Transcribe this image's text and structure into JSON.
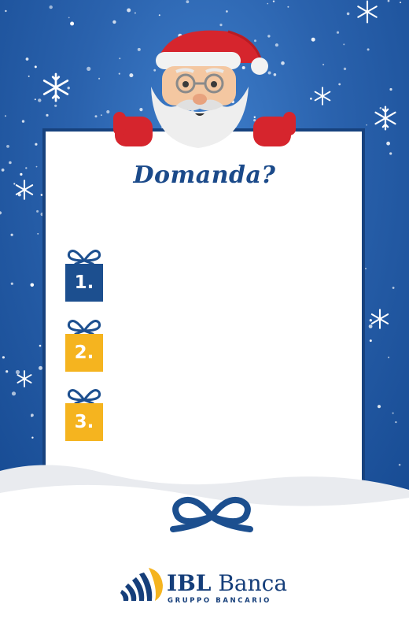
{
  "card": {
    "title": "Domanda?",
    "items": [
      {
        "number": "1.",
        "color": "#1c4f8f"
      },
      {
        "number": "2.",
        "color": "#f5b41f"
      },
      {
        "number": "3.",
        "color": "#f5b41f"
      }
    ]
  },
  "logo": {
    "name_part1": "IBL",
    "name_part2": "Banca",
    "subtitle": "GRUPPO BANCARIO"
  },
  "colors": {
    "background_blue": "#2a62ad",
    "navy": "#17427e",
    "gold": "#f5b41f",
    "santa_red": "#d6252d"
  },
  "icons": [
    "snowflake-icon",
    "santa-claus-illustration",
    "gift-icon",
    "ribbon-bow-icon",
    "ibl-banca-logo"
  ]
}
